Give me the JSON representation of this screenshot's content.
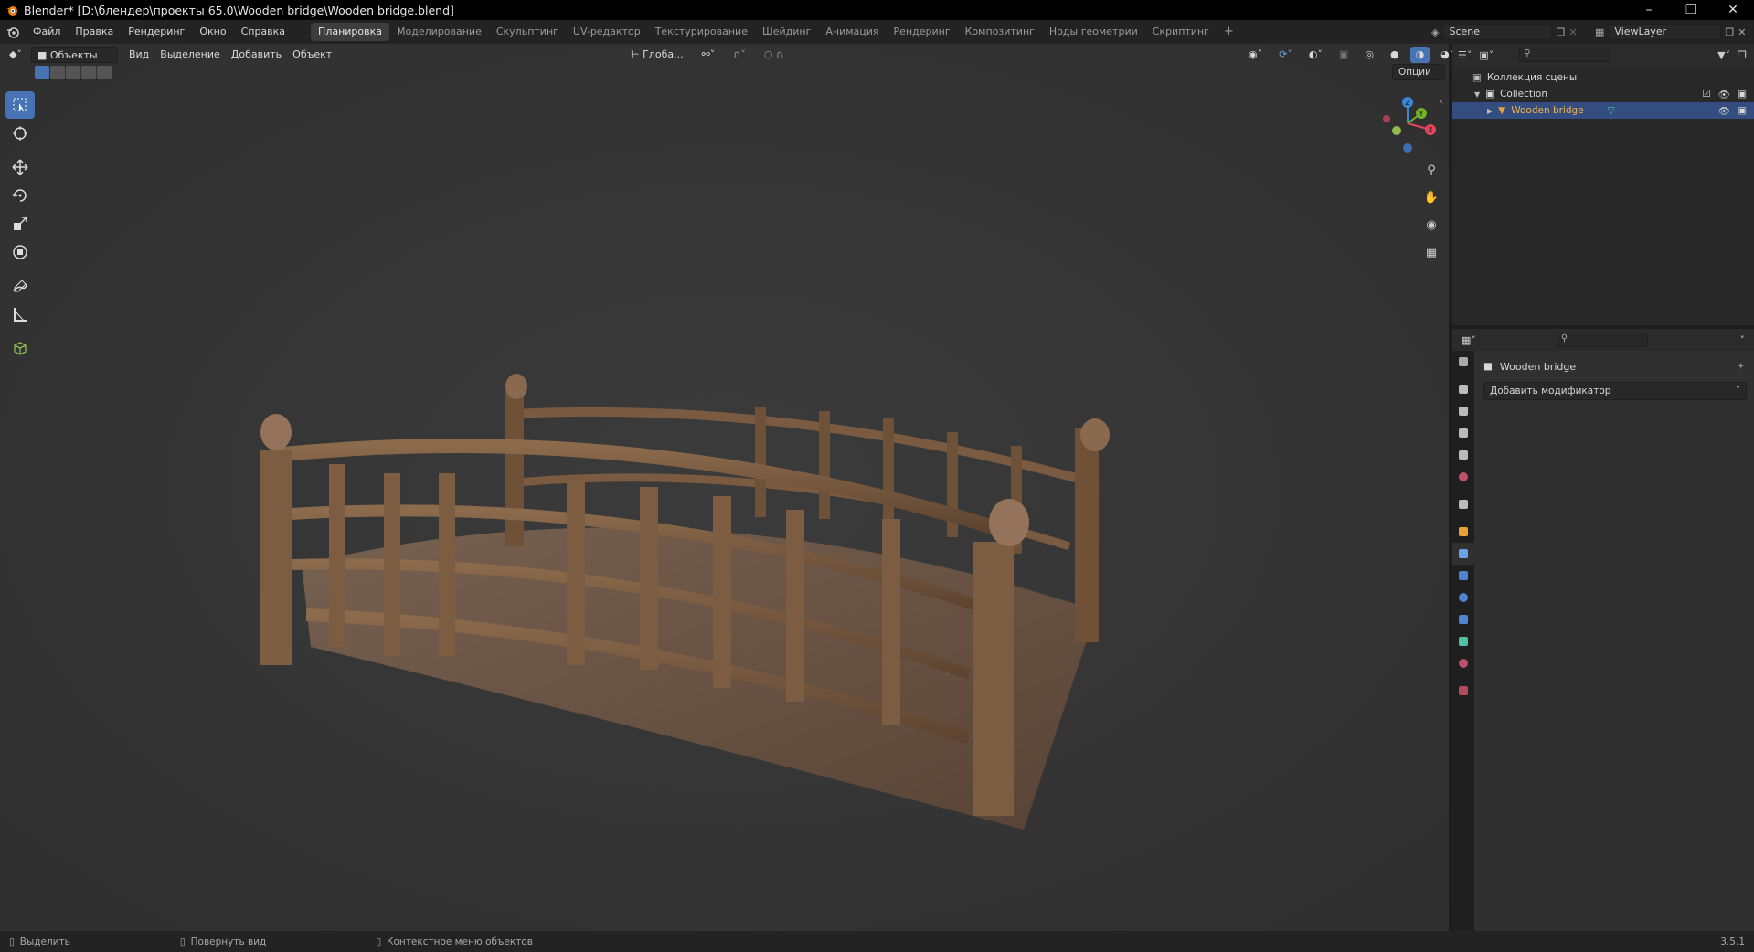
{
  "window": {
    "title": "Blender* [D:\\блендер\\проекты 65.0\\Wooden bridge\\Wooden bridge.blend]"
  },
  "menu": {
    "items": [
      "Файл",
      "Правка",
      "Рендеринг",
      "Окно",
      "Справка"
    ]
  },
  "workspaces": {
    "tabs": [
      "Планировка",
      "Моделирование",
      "Скульптинг",
      "UV-редактор",
      "Текстурирование",
      "Шейдинг",
      "Анимация",
      "Рендеринг",
      "Композитинг",
      "Ноды геометрии",
      "Скриптинг"
    ],
    "active": "Планировка",
    "add_label": "+"
  },
  "scene": {
    "scene_name": "Scene",
    "view_layer": "ViewLayer"
  },
  "viewport_header": {
    "mode": "Объекты",
    "menus": [
      "Вид",
      "Выделение",
      "Добавить",
      "Объект"
    ],
    "transform_orientation": "Глоба...",
    "options_label": "Опции"
  },
  "gizmo": {
    "axes": [
      "X",
      "Y",
      "Z"
    ]
  },
  "outliner": {
    "root": "Коллекция сцены",
    "collection": "Collection",
    "object": "Wooden bridge"
  },
  "properties": {
    "object_name": "Wooden bridge",
    "add_modifier": "Добавить модификатор"
  },
  "statusbar": {
    "items": [
      "Выделить",
      "Повернуть вид",
      "Контекстное меню объектов"
    ],
    "version": "3.5.1"
  },
  "colors": {
    "accent": "#4772b3",
    "selected_row": "#334d80",
    "object_orange": "#e8a23a",
    "axis_x": "#e3465c",
    "axis_y": "#72b02a",
    "axis_z": "#3b86d6"
  }
}
